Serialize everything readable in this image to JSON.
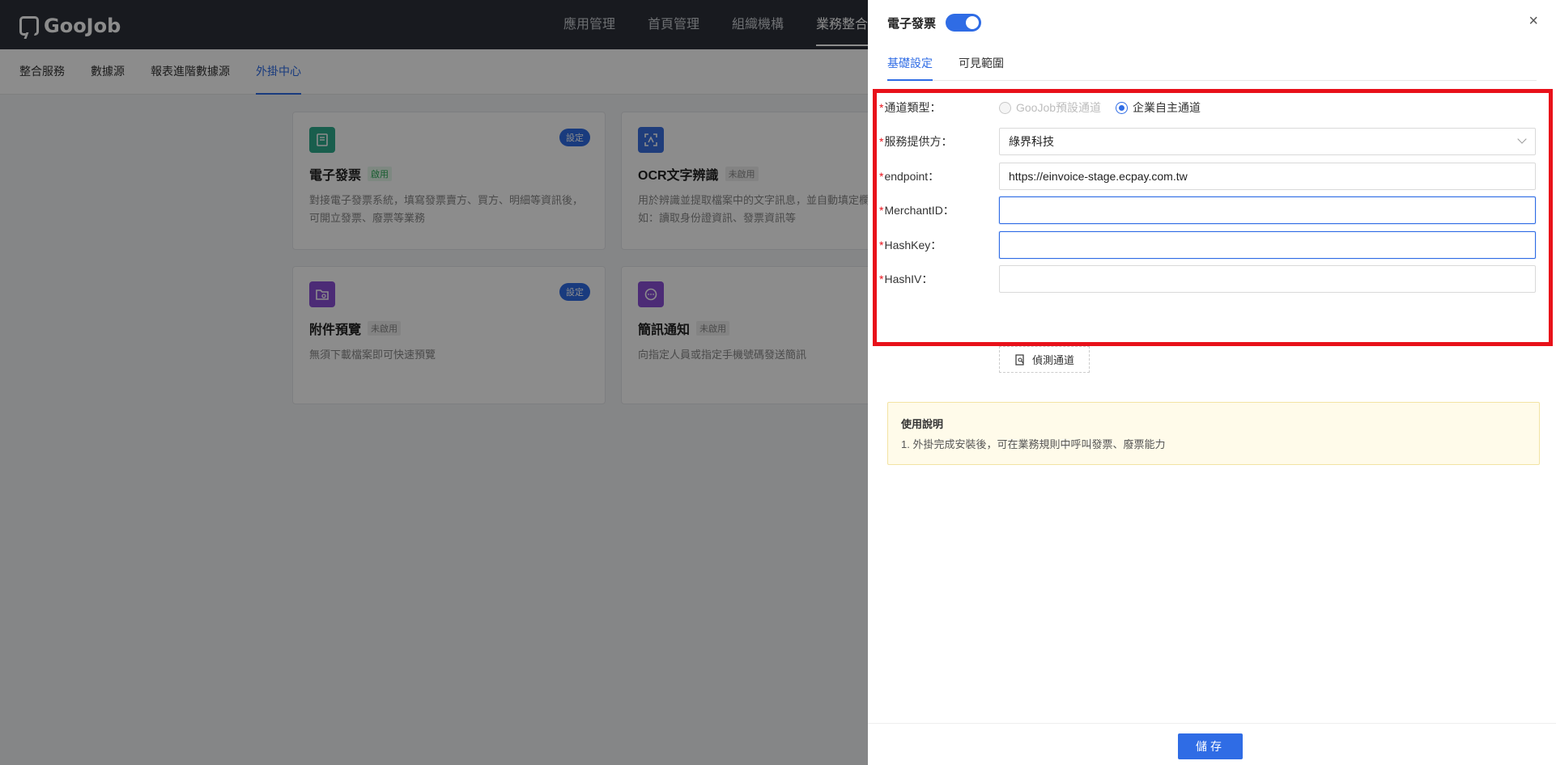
{
  "app": {
    "logo_text": "GooJob"
  },
  "topnav": {
    "items": [
      "應用管理",
      "首頁管理",
      "組織機構",
      "業務整合"
    ],
    "active": "業務整合"
  },
  "subnav": {
    "items": [
      "整合服務",
      "數據源",
      "報表進階數據源",
      "外掛中心"
    ],
    "active": "外掛中心"
  },
  "cards": [
    {
      "title": "電子發票",
      "status": "啟用",
      "setting": "設定",
      "desc": "對接電子發票系統，填寫發票賣方、買方、明細等資訊後，可開立發票、廢票等業務",
      "icon": "invoice-icon",
      "icon_color": "#2eab8d"
    },
    {
      "title": "OCR文字辨識",
      "status": "未啟用",
      "desc": "用於辨識並提取檔案中的文字訊息，並自動填定欄位，例如：讀取身份證資訊、發票資訊等",
      "icon": "ocr-scan-icon",
      "icon_color": "#3a6fe0"
    },
    {
      "title": "附件預覽",
      "status": "未啟用",
      "setting": "設定",
      "desc": "無須下載檔案即可快速預覽",
      "icon": "folder-preview-icon",
      "icon_color": "#8a4fd8"
    },
    {
      "title": "簡訊通知",
      "status": "未啟用",
      "desc": "向指定人員或指定手機號碼發送簡訊",
      "icon": "chat-bubble-icon",
      "icon_color": "#8a4fd8"
    }
  ],
  "drawer": {
    "title": "電子發票",
    "toggle_on": true,
    "close_label": "×",
    "tabs": [
      "基礎設定",
      "可見範圍"
    ],
    "active_tab": "基礎設定",
    "form": {
      "channel_type": {
        "label": "通道類型：",
        "options": [
          "GooJob預設通道",
          "企業自主通道"
        ],
        "selected": "企業自主通道"
      },
      "provider": {
        "label": "服務提供方：",
        "value": "綠界科技"
      },
      "endpoint": {
        "label": "endpoint：",
        "value": "https://einvoice-stage.ecpay.com.tw"
      },
      "merchant_id": {
        "label": "MerchantID：",
        "value": ""
      },
      "hash_key": {
        "label": "HashKey：",
        "value": ""
      },
      "hash_iv": {
        "label": "HashIV：",
        "value": ""
      }
    },
    "detect_button": "偵測通道",
    "note": {
      "heading": "使用說明",
      "text": "1. 外掛完成安裝後，可在業務規則中呼叫發票、廢票能力"
    },
    "save_button": "儲存",
    "colors": {
      "accent": "#2f6ce5",
      "highlight": "#e8111a"
    }
  }
}
